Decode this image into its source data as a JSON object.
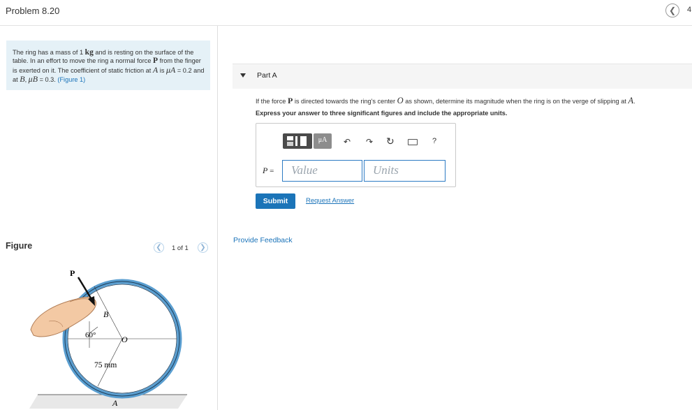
{
  "header": {
    "title": "Problem 8.20",
    "nav_back_icon": "chevron-left-icon",
    "trail": "4"
  },
  "problem": {
    "t1": "The ring has a mass of 1 ",
    "mass_unit": "kg",
    "t2": " and is resting on the surface of the table. In an effort to move the ring a normal force ",
    "force_symbol": "P",
    "t3": " from the finger is exerted on it. The coefficient of static friction at ",
    "point_a": "A",
    "t4": " is ",
    "mu_a": "μA",
    "t5": " = 0.2 and at ",
    "point_b": "B",
    "t6": ", ",
    "mu_b": "μB",
    "t7": " = 0.3. ",
    "figure_link": "(Figure 1)"
  },
  "figure_panel": {
    "label": "Figure",
    "pager": "1 of 1",
    "prev_icon": "chevron-left-icon",
    "next_icon": "chevron-right-icon",
    "labels": {
      "p": "P",
      "b": "B",
      "angle": "60°",
      "o": "O",
      "radius": "75 mm",
      "a": "A"
    }
  },
  "part_a": {
    "title": "Part A",
    "q1": "If the force ",
    "q_force": "P",
    "q2": " is directed towards the ring's center ",
    "q_center": "O",
    "q3": " as shown, determine its magnitude when the ring is on the verge of slipping at ",
    "q_point": "A",
    "q4": ".",
    "instruction": "Express your answer to three significant figures and include the appropriate units.",
    "toolbar": {
      "units_btn": "μA",
      "undo_icon": "undo-icon",
      "redo_icon": "redo-icon",
      "reset_icon": "reset-icon",
      "keyboard_icon": "keyboard-icon",
      "help": "?"
    },
    "var_label": "P",
    "equals": " =",
    "value_placeholder": "Value",
    "units_placeholder": "Units",
    "submit": "Submit",
    "request_answer": "Request Answer"
  },
  "feedback_link": "Provide Feedback",
  "colors": {
    "accent": "#1b74b8",
    "problem_bg": "#e5f1f7",
    "ring": "#5a9ed0"
  }
}
